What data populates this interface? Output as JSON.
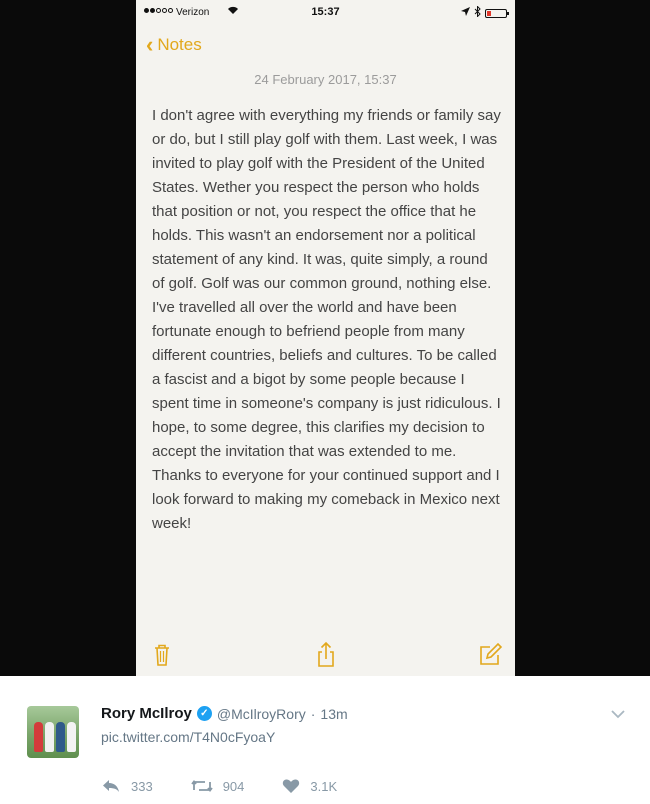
{
  "status_bar": {
    "carrier": "Verizon",
    "time": "15:37",
    "wifi_icon": "wifi-icon",
    "battery_color": "#e0382c"
  },
  "notes_app": {
    "back_label": "Notes",
    "date": "24 February 2017, 15:37",
    "body": "I don't agree with everything my friends or family say or do, but I still play golf with them. Last week, I was invited to play golf with the President of the United States. Wether you respect the person who holds that position or not, you respect the office that he holds. This wasn't an endorsement nor a political statement of any kind. It was, quite simply, a round of golf. Golf was our common ground, nothing else. I've travelled all over the world and have been fortunate enough to befriend people from many different countries, beliefs and cultures. To be called a fascist and a bigot by some people because I spent time in someone's company is just ridiculous. I hope, to some degree, this clarifies my decision to accept the invitation that was extended to me. Thanks to everyone for your continued support and I look forward to making my comeback in Mexico next week!",
    "accent_color": "#e2a81c",
    "toolbar_icons": [
      "trash-icon",
      "share-icon",
      "compose-icon"
    ]
  },
  "tweet": {
    "name": "Rory McIlroy",
    "handle": "@McIlroyRory",
    "separator": "·",
    "time": "13m",
    "link": "pic.twitter.com/T4N0cFyoaY",
    "reply_count": "333",
    "retweet_count": "904",
    "like_count": "3.1K",
    "verified_color": "#1da1f2"
  }
}
